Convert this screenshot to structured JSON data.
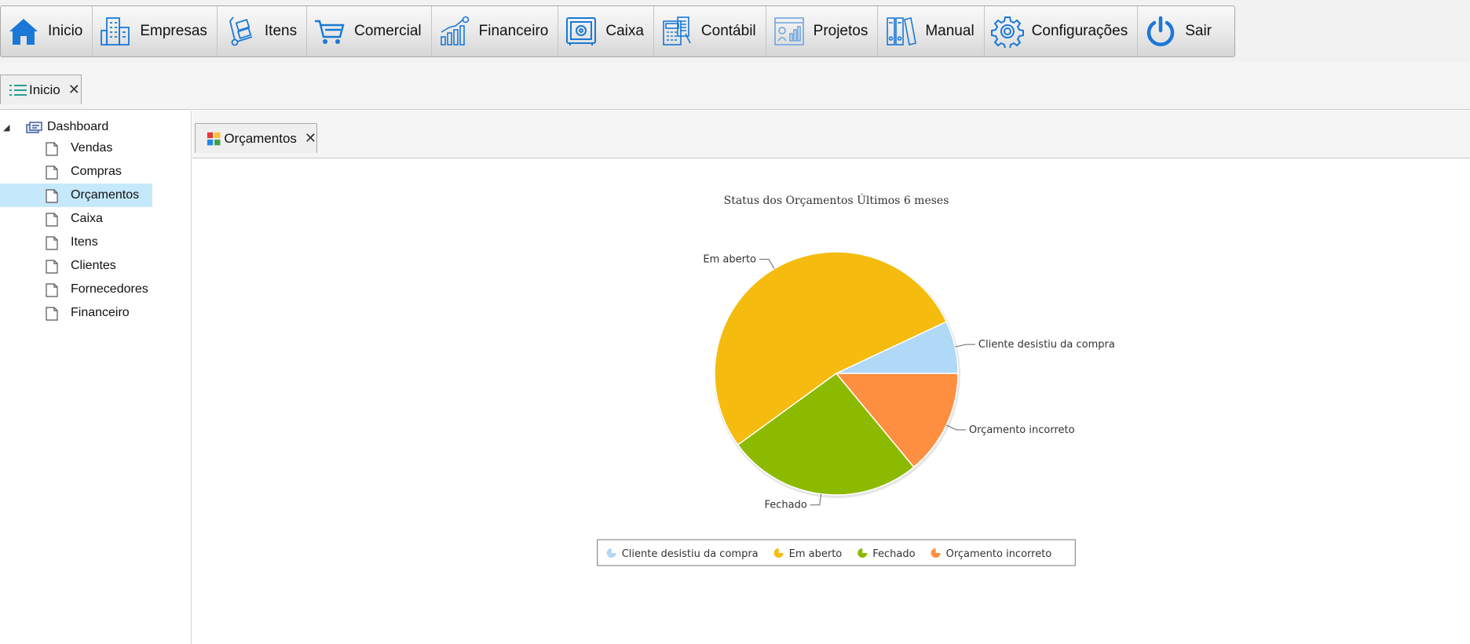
{
  "menu": {
    "items": [
      {
        "label": "Inicio",
        "icon": "home-icon"
      },
      {
        "label": "Empresas",
        "icon": "buildings-icon"
      },
      {
        "label": "Itens",
        "icon": "hand-truck-icon"
      },
      {
        "label": "Comercial",
        "icon": "shopping-cart-icon"
      },
      {
        "label": "Financeiro",
        "icon": "bar-chart-icon"
      },
      {
        "label": "Caixa",
        "icon": "safe-icon"
      },
      {
        "label": "Contábil",
        "icon": "calculator-icon"
      },
      {
        "label": "Projetos",
        "icon": "project-board-icon"
      },
      {
        "label": "Manual",
        "icon": "binders-icon"
      },
      {
        "label": "Configurações",
        "icon": "gear-icon"
      },
      {
        "label": "Sair",
        "icon": "power-icon"
      }
    ]
  },
  "tabs": {
    "main": {
      "label": "Inicio",
      "close": "✕"
    },
    "content": {
      "label": "Orçamentos",
      "close": "✕"
    }
  },
  "sidebar": {
    "root": {
      "label": "Dashboard",
      "expander": "◢"
    },
    "items": [
      {
        "label": "Vendas"
      },
      {
        "label": "Compras"
      },
      {
        "label": "Orçamentos",
        "selected": true
      },
      {
        "label": "Caixa"
      },
      {
        "label": "Itens"
      },
      {
        "label": "Clientes"
      },
      {
        "label": "Fornecedores"
      },
      {
        "label": "Financeiro"
      }
    ]
  },
  "colors": {
    "accent": "#1a78d6",
    "selected_row": "#c5e9fb"
  },
  "chart_data": {
    "type": "pie",
    "title": "Status dos Orçamentos Últimos 6 meses",
    "categories": [
      "Cliente desistiu da compra",
      "Em aberto",
      "Fechado",
      "Orçamento incorreto"
    ],
    "values": [
      7,
      53,
      26,
      14
    ],
    "colors": [
      "#b0d8f7",
      "#f5bc0f",
      "#8cba00",
      "#ff8f40"
    ],
    "legend": "bottom"
  }
}
